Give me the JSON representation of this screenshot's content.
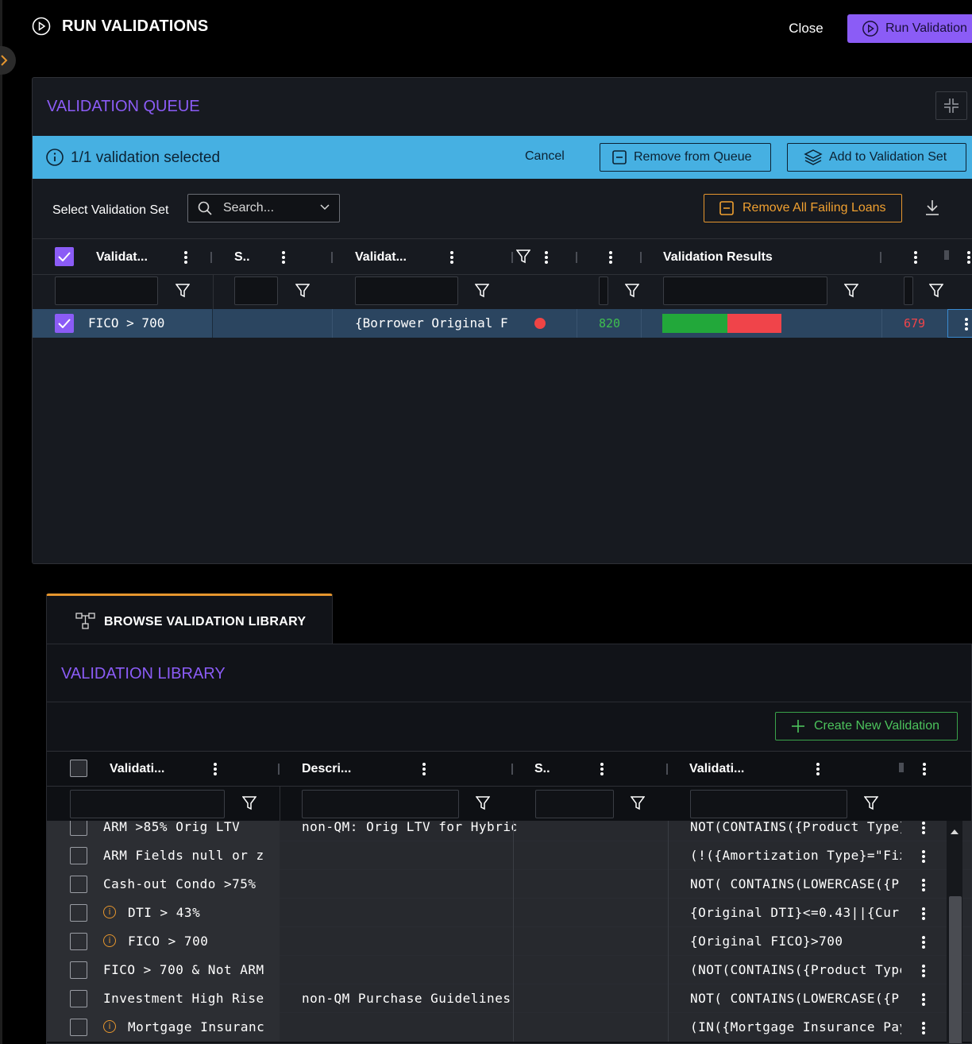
{
  "header": {
    "title": "RUN VALIDATIONS",
    "close_label": "Close",
    "run_label": "Run Validation"
  },
  "queue": {
    "title": "VALIDATION QUEUE",
    "selection_text": "1/1 validation selected",
    "cancel_label": "Cancel",
    "remove_queue_label": "Remove from Queue",
    "add_set_label": "Add to Validation Set",
    "select_set_label": "Select Validation Set",
    "search_placeholder": "Search...",
    "remove_failing_label": "Remove All Failing Loans",
    "columns": [
      "Validat...",
      "S..",
      "Validat...",
      "Validation Results"
    ],
    "row": {
      "name": "FICO > 700",
      "expression": "{Borrower Original F",
      "status_color": "#ef4444",
      "pass_count": "820",
      "fail_count": "679",
      "pass_fraction": 0.547,
      "pass_color": "#22a83a",
      "fail_color": "#f0444a"
    }
  },
  "library": {
    "tab_label": "BROWSE VALIDATION LIBRARY",
    "title": "VALIDATION LIBRARY",
    "create_label": "Create New Validation",
    "columns": [
      "Validati...",
      "Descri...",
      "S..",
      "Validati..."
    ],
    "rows": [
      {
        "name": "ARM >85% Orig LTV",
        "warn": false,
        "description": "non-QM: Orig LTV for Hybrid",
        "expression": "NOT(CONTAINS({Product Type}"
      },
      {
        "name": "ARM Fields null or z",
        "warn": false,
        "description": "",
        "expression": "(!({Amortization Type}=\"Fix"
      },
      {
        "name": "Cash-out Condo >75%",
        "warn": false,
        "description": "",
        "expression": "NOT( CONTAINS(LOWERCASE({Pr"
      },
      {
        "name": "DTI > 43%",
        "warn": true,
        "description": "",
        "expression": "{Original DTI}<=0.43||{Curr"
      },
      {
        "name": "FICO > 700",
        "warn": true,
        "description": "",
        "expression": "{Original FICO}>700"
      },
      {
        "name": "FICO > 700 & Not ARM",
        "warn": false,
        "description": "",
        "expression": "(NOT(CONTAINS({Product Type"
      },
      {
        "name": "Investment High Rise",
        "warn": false,
        "description": "non-QM Purchase Guidelines",
        "expression": "NOT( CONTAINS(LOWERCASE({Pr"
      },
      {
        "name": "Mortgage Insuranc",
        "warn": true,
        "description": "",
        "expression": "(IN({Mortgage Insurance Pay"
      }
    ]
  },
  "colors": {
    "accent": "#8b5cf6",
    "info_bar": "#46b0e2",
    "warning": "#e6962e",
    "success": "#4cc35c",
    "selected_row": "#2b4560"
  }
}
